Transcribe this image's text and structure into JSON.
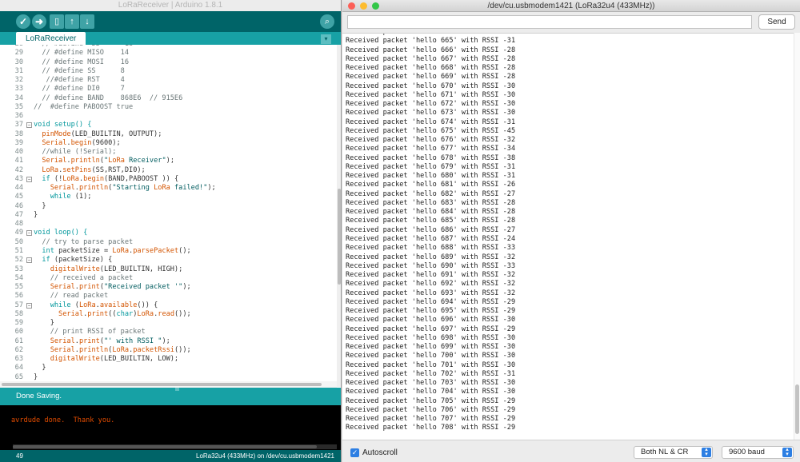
{
  "ide": {
    "title": "LoRaReceiver | Arduino 1.8.1",
    "tab_label": "LoRaReceiver",
    "status": "Done Saving.",
    "console": "avrdude done.  Thank you.",
    "footer_line": "49",
    "footer_board": "LoRa32u4 (433MHz) on /dev/cu.usbmodem1421",
    "tab_menu_icon": "▾",
    "toolbar_icons": [
      "verify-icon",
      "upload-icon",
      "new-icon",
      "open-icon",
      "save-icon",
      "serial-monitor-icon"
    ],
    "code": [
      {
        "n": "28",
        "t": "  // #define  SS      18",
        "c": "cm"
      },
      {
        "n": "29",
        "t": "  // #define MISO    14",
        "c": "cm"
      },
      {
        "n": "30",
        "t": "  // #define MOSI    16",
        "c": "cm"
      },
      {
        "n": "31",
        "t": "  // #define SS      8",
        "c": "cm"
      },
      {
        "n": "32",
        "t": "   //#define RST     4",
        "c": "cm"
      },
      {
        "n": "33",
        "t": "  // #define DI0     7",
        "c": "cm"
      },
      {
        "n": "34",
        "t": "  // #define BAND    868E6  // 915E6",
        "c": "cm"
      },
      {
        "n": "35",
        "t": "//  #define PABOOST true",
        "c": "cm"
      },
      {
        "n": "36",
        "t": "",
        "c": ""
      },
      {
        "n": "37",
        "t": "void setup() {",
        "c": "kw",
        "fold": true
      },
      {
        "n": "38",
        "t": "  pinMode(LED_BUILTIN, OUTPUT);",
        "c": ""
      },
      {
        "n": "39",
        "t": "  Serial.begin(9600);",
        "c": ""
      },
      {
        "n": "40",
        "t": "  //while (!Serial);",
        "c": "cm"
      },
      {
        "n": "41",
        "t": "  Serial.println(\"LoRa Receiver\");",
        "c": ""
      },
      {
        "n": "42",
        "t": "  LoRa.setPins(SS,RST,DI0);",
        "c": ""
      },
      {
        "n": "43",
        "t": "  if (!LoRa.begin(BAND,PABOOST )) {",
        "c": "",
        "fold": true
      },
      {
        "n": "44",
        "t": "    Serial.println(\"Starting LoRa failed!\");",
        "c": ""
      },
      {
        "n": "45",
        "t": "    while (1);",
        "c": ""
      },
      {
        "n": "46",
        "t": "  }",
        "c": ""
      },
      {
        "n": "47",
        "t": "}",
        "c": ""
      },
      {
        "n": "48",
        "t": "",
        "c": ""
      },
      {
        "n": "49",
        "t": "void loop() {",
        "c": "kw",
        "fold": true
      },
      {
        "n": "50",
        "t": "  // try to parse packet",
        "c": "cm"
      },
      {
        "n": "51",
        "t": "  int packetSize = LoRa.parsePacket();",
        "c": ""
      },
      {
        "n": "52",
        "t": "  if (packetSize) {",
        "c": "",
        "fold": true
      },
      {
        "n": "53",
        "t": "    digitalWrite(LED_BUILTIN, HIGH);",
        "c": ""
      },
      {
        "n": "54",
        "t": "    // received a packet",
        "c": "cm"
      },
      {
        "n": "55",
        "t": "    Serial.print(\"Received packet '\");",
        "c": ""
      },
      {
        "n": "56",
        "t": "    // read packet",
        "c": "cm"
      },
      {
        "n": "57",
        "t": "    while (LoRa.available()) {",
        "c": "",
        "fold": true
      },
      {
        "n": "58",
        "t": "      Serial.print((char)LoRa.read());",
        "c": ""
      },
      {
        "n": "59",
        "t": "    }",
        "c": ""
      },
      {
        "n": "60",
        "t": "    // print RSSI of packet",
        "c": "cm"
      },
      {
        "n": "61",
        "t": "    Serial.print(\"' with RSSI \");",
        "c": ""
      },
      {
        "n": "62",
        "t": "    Serial.println(LoRa.packetRssi());",
        "c": ""
      },
      {
        "n": "63",
        "t": "    digitalWrite(LED_BUILTIN, LOW);",
        "c": ""
      },
      {
        "n": "64",
        "t": "  }",
        "c": ""
      },
      {
        "n": "65",
        "t": "}",
        "c": ""
      }
    ]
  },
  "serial": {
    "title": "/dev/cu.usbmodem1421 (LoRa32u4 (433MHz))",
    "input_value": "",
    "send_label": "Send",
    "autoscroll_label": "Autoscroll",
    "line_ending": "Both NL & CR",
    "baud": "9600 baud",
    "lines": [
      "Received packet 'hello 664' with RSSI -29",
      "Received packet 'hello 665' with RSSI -31",
      "Received packet 'hello 666' with RSSI -28",
      "Received packet 'hello 667' with RSSI -28",
      "Received packet 'hello 668' with RSSI -28",
      "Received packet 'hello 669' with RSSI -28",
      "Received packet 'hello 670' with RSSI -30",
      "Received packet 'hello 671' with RSSI -30",
      "Received packet 'hello 672' with RSSI -30",
      "Received packet 'hello 673' with RSSI -30",
      "Received packet 'hello 674' with RSSI -31",
      "Received packet 'hello 675' with RSSI -45",
      "Received packet 'hello 676' with RSSI -32",
      "Received packet 'hello 677' with RSSI -34",
      "Received packet 'hello 678' with RSSI -38",
      "Received packet 'hello 679' with RSSI -31",
      "Received packet 'hello 680' with RSSI -31",
      "Received packet 'hello 681' with RSSI -26",
      "Received packet 'hello 682' with RSSI -27",
      "Received packet 'hello 683' with RSSI -28",
      "Received packet 'hello 684' with RSSI -28",
      "Received packet 'hello 685' with RSSI -28",
      "Received packet 'hello 686' with RSSI -27",
      "Received packet 'hello 687' with RSSI -24",
      "Received packet 'hello 688' with RSSI -33",
      "Received packet 'hello 689' with RSSI -32",
      "Received packet 'hello 690' with RSSI -33",
      "Received packet 'hello 691' with RSSI -32",
      "Received packet 'hello 692' with RSSI -32",
      "Received packet 'hello 693' with RSSI -32",
      "Received packet 'hello 694' with RSSI -29",
      "Received packet 'hello 695' with RSSI -29",
      "Received packet 'hello 696' with RSSI -30",
      "Received packet 'hello 697' with RSSI -29",
      "Received packet 'hello 698' with RSSI -30",
      "Received packet 'hello 699' with RSSI -30",
      "Received packet 'hello 700' with RSSI -30",
      "Received packet 'hello 701' with RSSI -30",
      "Received packet 'hello 702' with RSSI -31",
      "Received packet 'hello 703' with RSSI -30",
      "Received packet 'hello 704' with RSSI -30",
      "Received packet 'hello 705' with RSSI -29",
      "Received packet 'hello 706' with RSSI -29",
      "Received packet 'hello 707' with RSSI -29",
      "Received packet 'hello 708' with RSSI -29"
    ],
    "traffic_lights": [
      "#fc5f57",
      "#fdbc2e",
      "#33c748"
    ]
  }
}
